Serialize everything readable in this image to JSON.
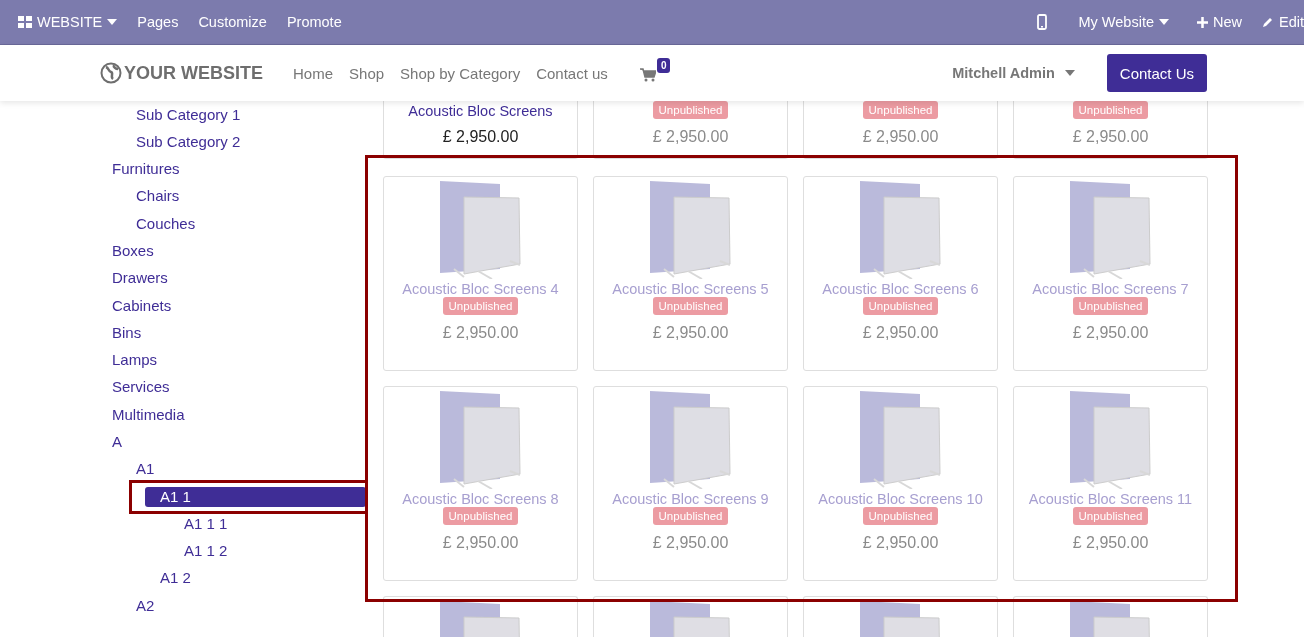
{
  "admin_bar": {
    "app": "WEBSITE",
    "left": [
      "Pages",
      "Customize",
      "Promote"
    ],
    "site": "My Website",
    "new": "New",
    "edit": "Edit"
  },
  "navbar": {
    "logo": "YOUR WEBSITE",
    "links": [
      "Home",
      "Shop",
      "Shop by Category",
      "Contact us"
    ],
    "cart_count": "0",
    "user": "Mitchell Admin",
    "cta": "Contact Us"
  },
  "categories": [
    {
      "children": [
        {
          "label": "Sub Category 1",
          "selected": false
        },
        {
          "label": "Sub Category 2",
          "selected": false
        }
      ]
    },
    {
      "label": "Furnitures",
      "selected": false,
      "children": [
        {
          "label": "Chairs",
          "selected": false
        },
        {
          "label": "Couches",
          "selected": false
        }
      ]
    },
    {
      "label": "Boxes",
      "selected": false
    },
    {
      "label": "Drawers",
      "selected": false
    },
    {
      "label": "Cabinets",
      "selected": false
    },
    {
      "label": "Bins",
      "selected": false
    },
    {
      "label": "Lamps",
      "selected": false
    },
    {
      "label": "Services",
      "selected": false
    },
    {
      "label": "Multimedia",
      "selected": false
    },
    {
      "label": "A",
      "selected": false,
      "children": [
        {
          "label": "A1",
          "selected": false,
          "children": [
            {
              "label": "A1 1",
              "selected": true,
              "children": [
                {
                  "label": "A1 1 1",
                  "selected": false
                },
                {
                  "label": "A1 1 2",
                  "selected": false
                }
              ]
            },
            {
              "label": "A1 2",
              "selected": false
            }
          ]
        },
        {
          "label": "A2",
          "selected": false
        }
      ]
    }
  ],
  "products": [
    {
      "name": "Acoustic Bloc Screens",
      "published": true,
      "price": "£ 2,950.00",
      "kind": "clipped"
    },
    {
      "published": false,
      "badge": "Unpublished",
      "price": "£ 2,950.00",
      "kind": "clipped"
    },
    {
      "published": false,
      "badge": "Unpublished",
      "price": "£ 2,950.00",
      "kind": "clipped"
    },
    {
      "published": false,
      "badge": "Unpublished",
      "price": "£ 2,950.00",
      "kind": "clipped"
    },
    {
      "name": "Acoustic Bloc Screens 4",
      "published": false,
      "badge": "Unpublished",
      "price": "£ 2,950.00",
      "kind": "full"
    },
    {
      "name": "Acoustic Bloc Screens 5",
      "published": false,
      "badge": "Unpublished",
      "price": "£ 2,950.00",
      "kind": "full"
    },
    {
      "name": "Acoustic Bloc Screens 6",
      "published": false,
      "badge": "Unpublished",
      "price": "£ 2,950.00",
      "kind": "full"
    },
    {
      "name": "Acoustic Bloc Screens 7",
      "published": false,
      "badge": "Unpublished",
      "price": "£ 2,950.00",
      "kind": "full"
    },
    {
      "name": "Acoustic Bloc Screens 8",
      "published": false,
      "badge": "Unpublished",
      "price": "£ 2,950.00",
      "kind": "full"
    },
    {
      "name": "Acoustic Bloc Screens 9",
      "published": false,
      "badge": "Unpublished",
      "price": "£ 2,950.00",
      "kind": "full"
    },
    {
      "name": "Acoustic Bloc Screens 10",
      "published": false,
      "badge": "Unpublished",
      "price": "£ 2,950.00",
      "kind": "full"
    },
    {
      "name": "Acoustic Bloc Screens 11",
      "published": false,
      "badge": "Unpublished",
      "price": "£ 2,950.00",
      "kind": "full"
    },
    {
      "published": false,
      "kind": "peek"
    },
    {
      "published": false,
      "kind": "peek"
    },
    {
      "published": false,
      "kind": "peek"
    },
    {
      "published": false,
      "kind": "peek"
    }
  ]
}
